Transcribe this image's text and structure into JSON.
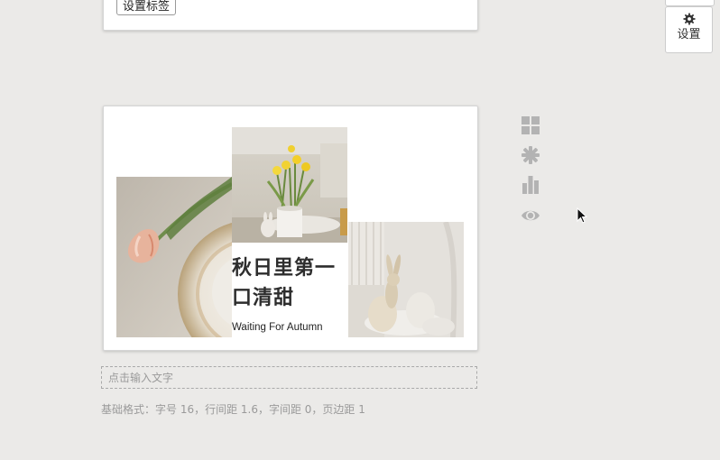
{
  "top_card": {
    "tag_button_label": "设置标签"
  },
  "settings": {
    "label": "设置",
    "icon": "gear-icon"
  },
  "preview": {
    "title": "秋日里第一口清甜",
    "subtitle": "Waiting For Autumn",
    "photos": [
      "tulip-teacup-photo",
      "yellow-tulips-vase-photo",
      "bunny-eggs-photo"
    ]
  },
  "side_tools": {
    "icons": [
      "grid-icon",
      "asterisk-icon",
      "bar-chart-icon",
      "eye-icon"
    ]
  },
  "editor": {
    "placeholder": "点击输入文字",
    "format_info": "基础格式：字号 16，行间距 1.6，字间距 0，页边距 1"
  },
  "colors": {
    "background": "#ebeae8",
    "card": "#ffffff",
    "icon_gray": "#b3b3b3",
    "title_text": "#2d2d2d"
  }
}
